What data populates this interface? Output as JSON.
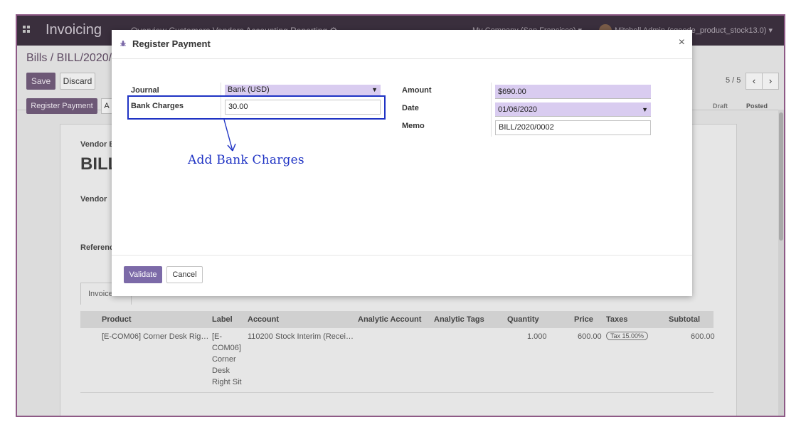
{
  "navbar": {
    "app_title": "Invoicing",
    "menu_text": "Overview   Customers   Vendors   Accounting   Reporting   ⚙",
    "company": "My Company (San Francisco) ▾",
    "user": "Mitchell Admin (sgeede_product_stock13.0) ▾"
  },
  "control_panel": {
    "breadcrumb": "Bills / BILL/2020/0",
    "save_label": "Save",
    "discard_label": "Discard",
    "pager": "5 / 5",
    "prev_icon": "‹",
    "next_icon": "›",
    "register_payment_label": "Register Payment",
    "action_a_label": "A",
    "status_draft": "Draft",
    "status_posted": "Posted"
  },
  "sheet": {
    "vendor_bill_label": "Vendor B",
    "bill_number": "BILL",
    "vendor_label": "Vendor",
    "reference_label": "Referenc",
    "tab_invoice": "Invoice",
    "table": {
      "headers": [
        "Product",
        "Label",
        "Account",
        "Analytic Account",
        "Analytic Tags",
        "Quantity",
        "Price",
        "Taxes",
        "Subtotal"
      ],
      "row": {
        "product": "[E-COM06] Corner Desk Rig…",
        "label_lines": [
          "[E-",
          "COM06]",
          "Corner",
          "Desk",
          "Right Sit"
        ],
        "account": "110200 Stock Interim (Recei…",
        "quantity": "1.000",
        "price": "600.00",
        "tax": "Tax 15.00%",
        "subtotal": "600.00"
      }
    }
  },
  "modal": {
    "title": "Register Payment",
    "close_icon": "×",
    "journal_label": "Journal",
    "journal_value": "Bank (USD)",
    "bank_charges_label": "Bank Charges",
    "bank_charges_value": "30.00",
    "amount_label": "Amount",
    "amount_value": "$690.00",
    "date_label": "Date",
    "date_value": "01/06/2020",
    "memo_label": "Memo",
    "memo_value": "BILL/2020/0002",
    "validate_label": "Validate",
    "cancel_label": "Cancel"
  },
  "annotation": {
    "text": "Add Bank Charges"
  },
  "colors": {
    "brand": "#7c6aa8",
    "highlight": "#1f33c4",
    "field_required": "#d9ccf0",
    "frame": "#8e5a86"
  }
}
